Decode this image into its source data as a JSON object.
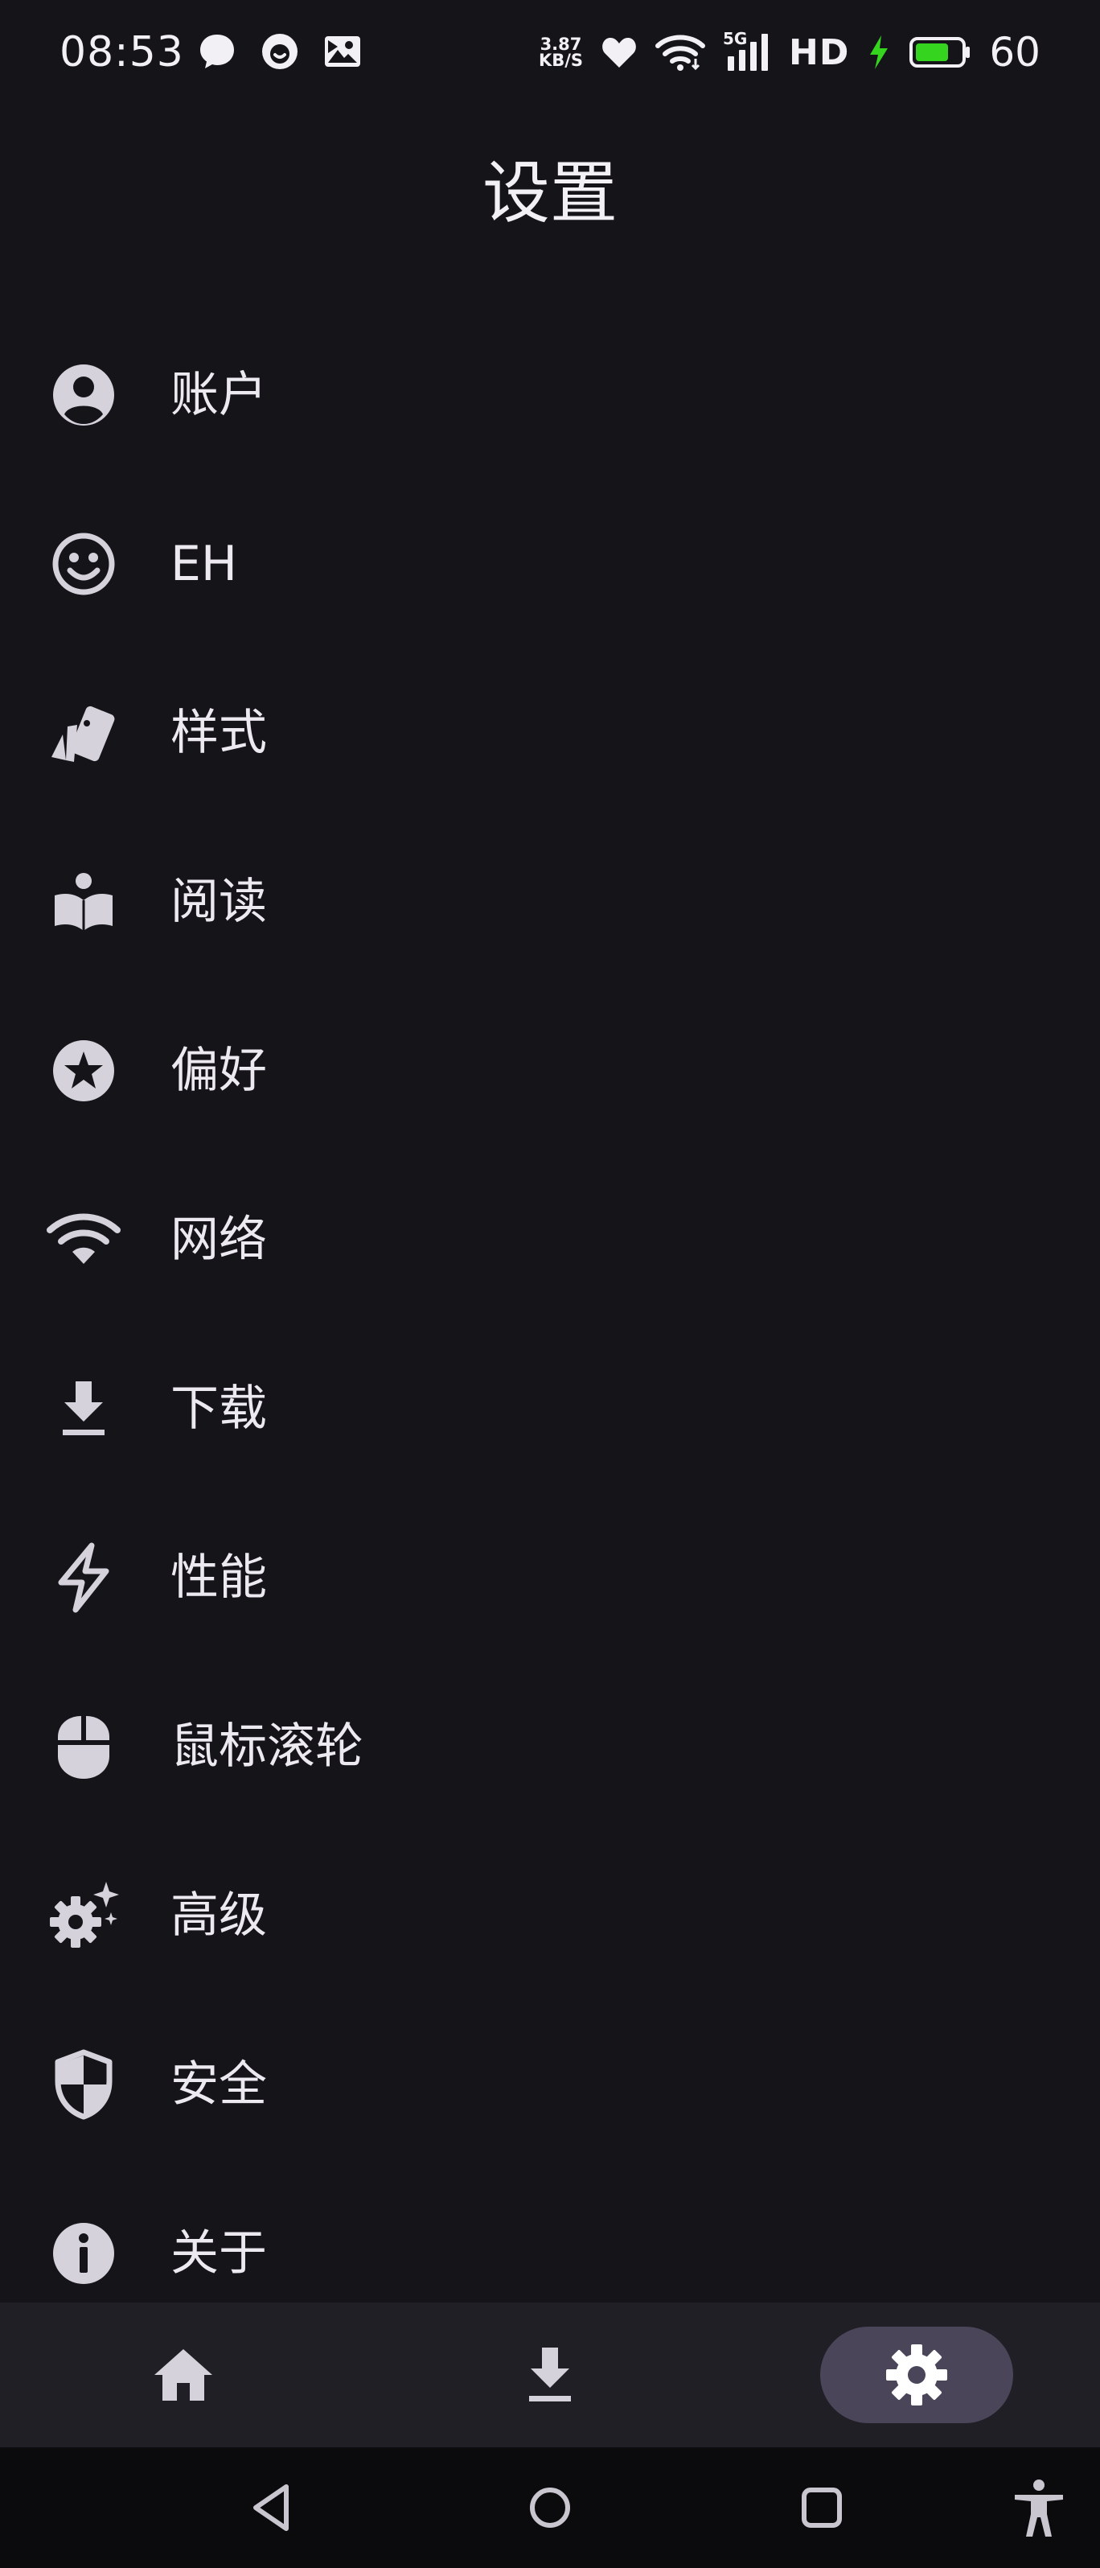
{
  "status_bar": {
    "time": "08:53",
    "net_speed_value": "3.87",
    "net_speed_unit": "KB/S",
    "network_type": "5G",
    "hd": "HD",
    "battery_level": "60",
    "colors": {
      "charging_green": "#35d41e"
    }
  },
  "title": "设置",
  "settings": {
    "items": [
      {
        "label": "账户",
        "icon": "account-circle-icon"
      },
      {
        "label": "EH",
        "icon": "smiley-face-icon"
      },
      {
        "label": "样式",
        "icon": "style-cards-icon"
      },
      {
        "label": "阅读",
        "icon": "reading-book-icon"
      },
      {
        "label": "偏好",
        "icon": "star-circle-icon"
      },
      {
        "label": "网络",
        "icon": "wifi-icon"
      },
      {
        "label": "下载",
        "icon": "download-icon"
      },
      {
        "label": "性能",
        "icon": "lightning-bolt-icon"
      },
      {
        "label": "鼠标滚轮",
        "icon": "mouse-icon"
      },
      {
        "label": "高级",
        "icon": "gear-sparkle-icon"
      },
      {
        "label": "安全",
        "icon": "shield-icon"
      },
      {
        "label": "关于",
        "icon": "info-icon"
      }
    ]
  },
  "bottom_nav": {
    "items": [
      {
        "name": "home",
        "icon": "home-icon",
        "active": false
      },
      {
        "name": "download",
        "icon": "download-icon",
        "active": false
      },
      {
        "name": "settings",
        "icon": "gear-icon",
        "active": true
      }
    ],
    "colors": {
      "background": "#211f26",
      "active_pill": "#4a4558"
    }
  },
  "system_nav": {
    "icons": [
      "back-triangle-icon",
      "home-circle-icon",
      "recents-square-icon",
      "accessibility-icon"
    ]
  }
}
